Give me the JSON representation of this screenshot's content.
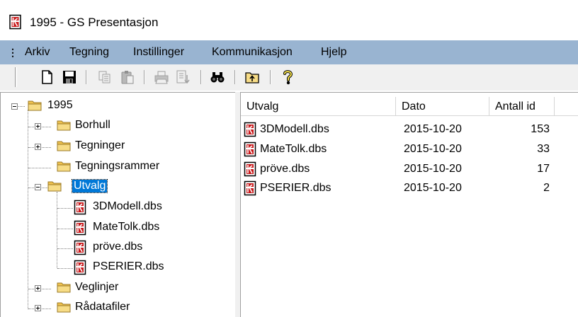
{
  "window": {
    "title": "1995 - GS Presentasjon"
  },
  "menu": [
    "Arkiv",
    "Tegning",
    "Instillinger",
    "Kommunikasjon",
    "Hjelp"
  ],
  "tree": {
    "root": "1995",
    "folders": [
      "Borhull",
      "Tegninger",
      "Tegningsrammer",
      "Utvalg",
      "Veglinjer",
      "Rådatafiler"
    ],
    "selected": "Utvalg",
    "utvalg_files": [
      "3DModell.dbs",
      "MateTolk.dbs",
      "pröve.dbs",
      "PSERIER.dbs"
    ]
  },
  "list": {
    "columns": [
      "Utvalg",
      "Dato",
      "Antall id"
    ],
    "rows": [
      {
        "name": "3DModell.dbs",
        "date": "2015-10-20",
        "count": "153"
      },
      {
        "name": "MateTolk.dbs",
        "date": "2015-10-20",
        "count": "33"
      },
      {
        "name": "pröve.dbs",
        "date": "2015-10-20",
        "count": "17"
      },
      {
        "name": "PSERIER.dbs",
        "date": "2015-10-20",
        "count": "2"
      }
    ]
  },
  "toolbar_icons": [
    "new-document-icon",
    "save-icon",
    "copy-icon",
    "paste-icon",
    "print-icon",
    "export-icon",
    "find-icon",
    "open-folder-icon",
    "help-icon"
  ],
  "colors": {
    "menubar": "#99b4d1",
    "selection": "#0078d7",
    "folder": "#f5d674",
    "dbs_icon": "#c8191b"
  }
}
